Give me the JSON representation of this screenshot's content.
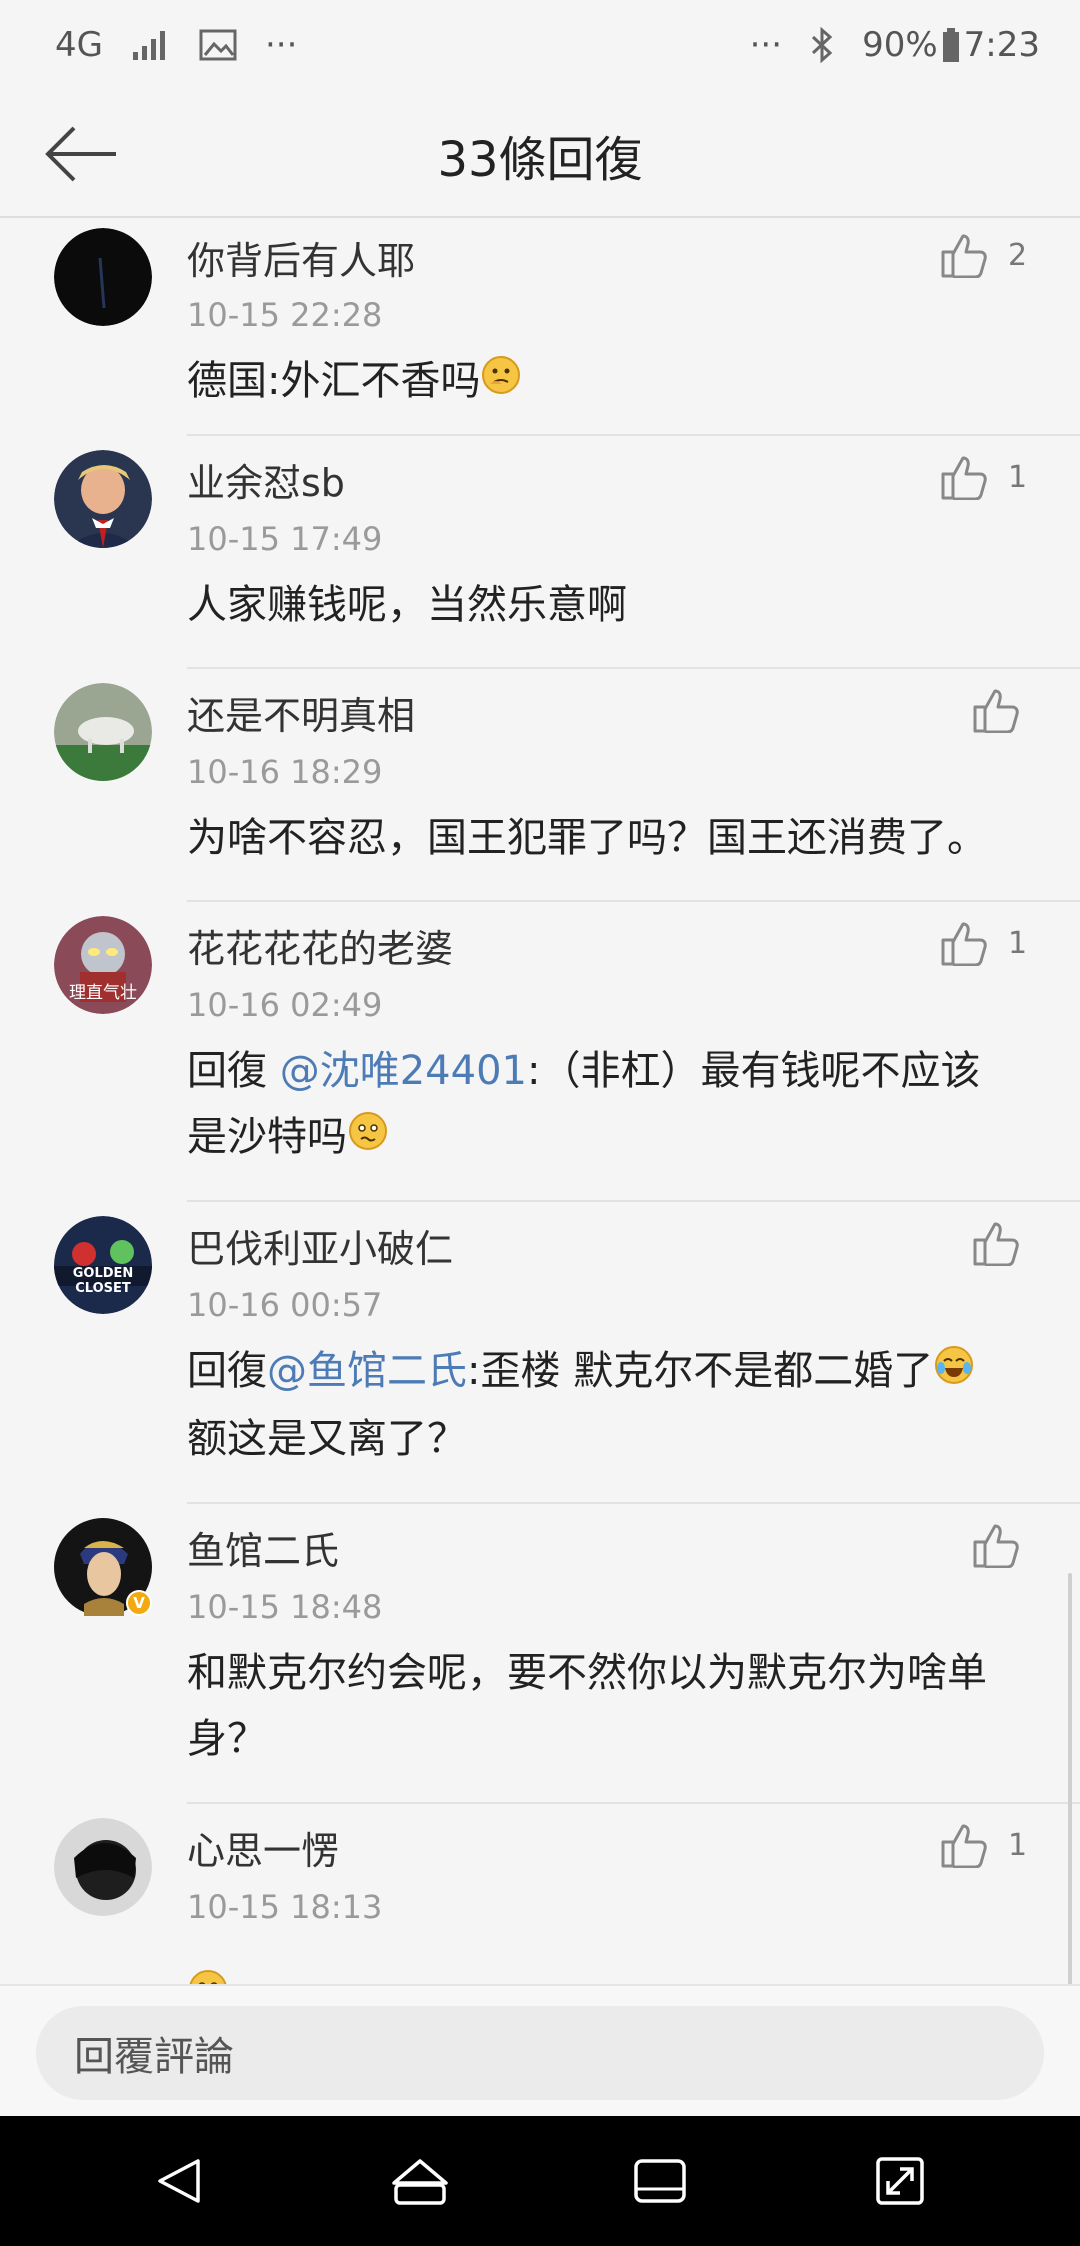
{
  "status_bar": {
    "network": "4G",
    "more_left": "···",
    "more_right": "···",
    "battery": "90%",
    "time": "7:23"
  },
  "header": {
    "title": "33條回復"
  },
  "comments": [
    {
      "name": "你背后有人耶",
      "time": "10-15 22:28",
      "likes": "2",
      "body": "德国:外汇不香吗",
      "emoji": "thinking-face",
      "avatar_color": "#0b0b0b"
    },
    {
      "name": "业余怼sb",
      "time": "10-15 17:49",
      "likes": "1",
      "body": "人家赚钱呢，当然乐意啊",
      "avatar_color": "#2a3550"
    },
    {
      "name": "还是不明真相",
      "time": "10-16 18:29",
      "likes": "",
      "body": "为啥不容忍，国王犯罪了吗？国王还消费了。",
      "avatar_color": "#7d8c6a"
    },
    {
      "name": "花花花花的老婆",
      "time": "10-16 02:49",
      "likes": "1",
      "reply_prefix": "回復 ",
      "mention": "@沈唯24401",
      "body": ":（非杠）最有钱呢不应该是沙特吗",
      "emoji": "confused-face",
      "avatar_text": "理直气壮",
      "avatar_color": "#8a4a58"
    },
    {
      "name": "巴伐利亚小破仁",
      "time": "10-16 00:57",
      "likes": "",
      "reply_prefix": "回復",
      "mention": "@鱼馆二氏",
      "body": ":歪楼 默克尔不是都二婚了",
      "body2": "额这是又离了？",
      "emoji": "tears-of-joy-face",
      "avatar_text": "GOLDEN CLOSET",
      "avatar_color": "#1b2a4a"
    },
    {
      "name": "鱼馆二氏",
      "time": "10-15 18:48",
      "likes": "",
      "body": "和默克尔约会呢，要不然你以为默克尔为啥单身？",
      "avatar_color": "#2b3a5e",
      "verified": "V"
    },
    {
      "name": "心思一愣",
      "time": "10-15 18:13",
      "likes": "1",
      "body": "",
      "emoji": "confused-face",
      "avatar_color": "#1e1e1e"
    }
  ],
  "reply_bar": {
    "placeholder": "回覆評論"
  },
  "colors": {
    "background": "#f5f5f5",
    "mention": "#4c7bb5",
    "timestamp": "#9a9a9a",
    "divider": "#e2e2e2"
  }
}
